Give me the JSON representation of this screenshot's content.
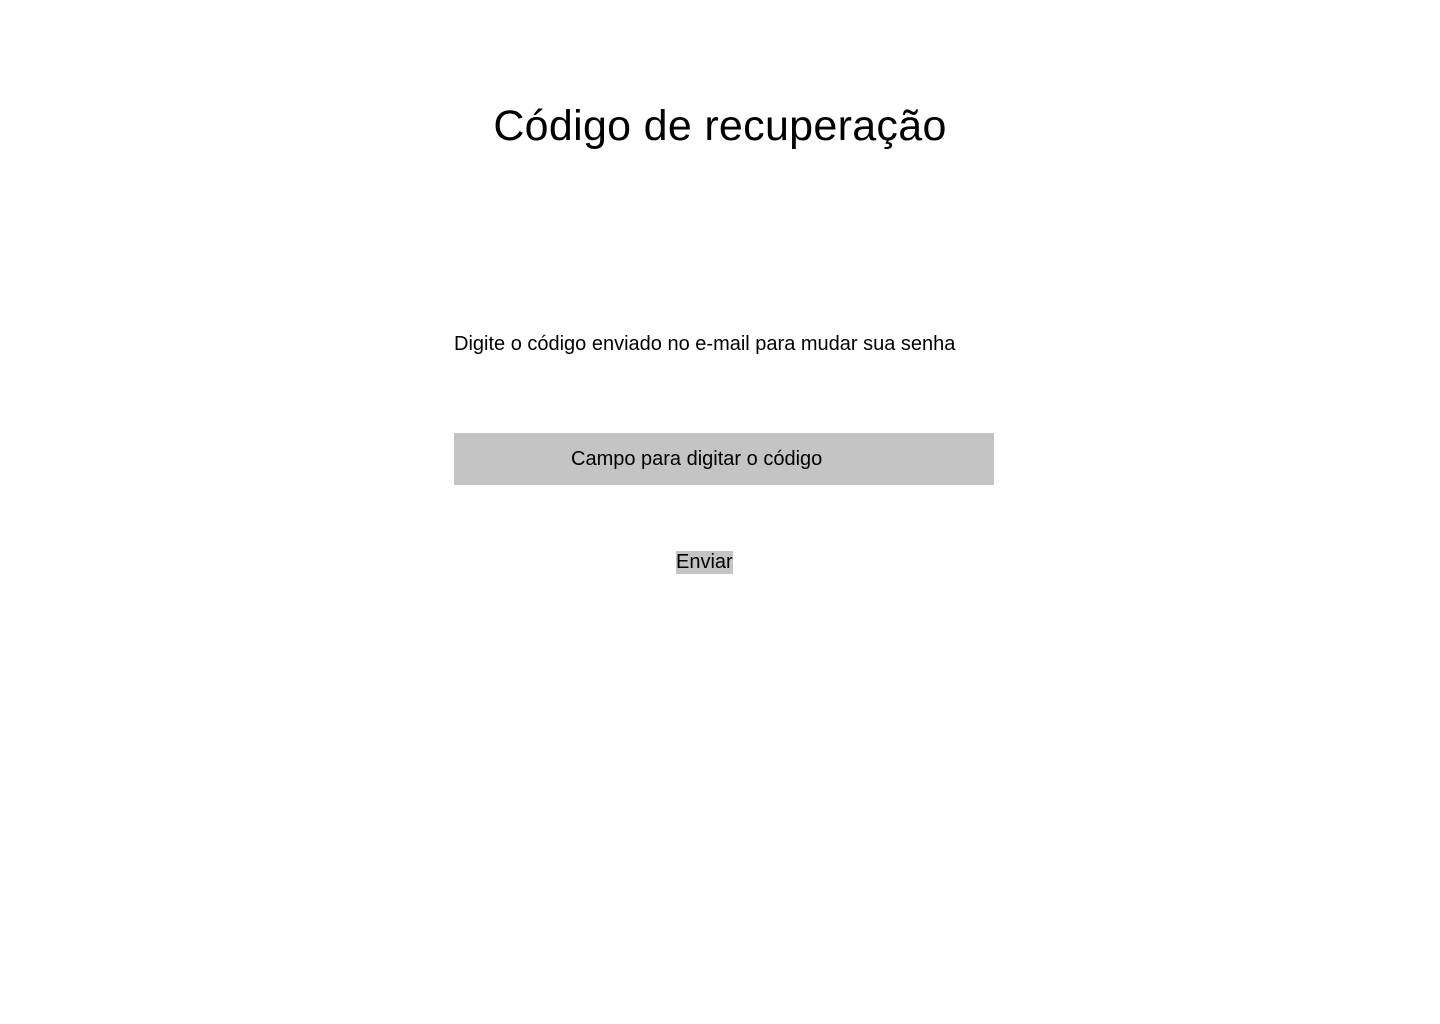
{
  "page": {
    "title": "Código de recuperação",
    "instruction": "Digite o código enviado no e-mail para mudar sua senha"
  },
  "code_field": {
    "value": "",
    "placeholder": "Campo para digitar o código"
  },
  "submit_button": {
    "label": "Enviar"
  },
  "colors": {
    "background": "#ffffff",
    "field_background": "#c4c4c4",
    "button_background": "#c4c4c4",
    "text": "#000000"
  }
}
